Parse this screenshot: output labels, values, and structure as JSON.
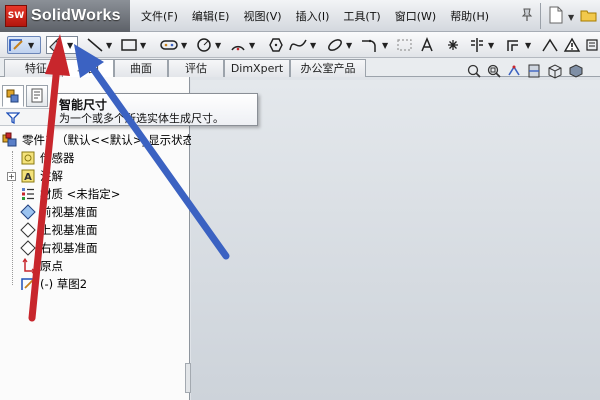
{
  "app": {
    "logo_mark": "SW",
    "logo_text": "SolidWorks"
  },
  "menu": [
    {
      "label": "文件(F)"
    },
    {
      "label": "编辑(E)"
    },
    {
      "label": "视图(V)"
    },
    {
      "label": "插入(I)"
    },
    {
      "label": "工具(T)"
    },
    {
      "label": "窗口(W)"
    },
    {
      "label": "帮助(H)"
    }
  ],
  "toolbar": {
    "icons": [
      "sketch-icon",
      "smart-dimension-icon",
      "line-icon",
      "rectangle-icon",
      "slot-icon",
      "circle-icon",
      "arc-icon",
      "polygon-icon",
      "spline-icon",
      "ellipse-icon",
      "fillet-icon",
      "construction-icon",
      "text-icon",
      "point-icon",
      "mirror-icon",
      "offset-icon",
      "relations-icon"
    ]
  },
  "tabs": [
    {
      "label": "特征"
    },
    {
      "label": "草图"
    },
    {
      "label": "曲面"
    },
    {
      "label": "评估"
    },
    {
      "label": "DimXpert"
    },
    {
      "label": "办公室产品"
    }
  ],
  "active_tab": "草图",
  "tooltip": {
    "title": "智能尺寸",
    "description": "为一个或多个所选实体生成尺寸。"
  },
  "tree": {
    "root": "零件1 （默认<<默认>_显示状态",
    "items": [
      {
        "label": "传感器"
      },
      {
        "label": "注解"
      },
      {
        "label": "材质 <未指定>"
      },
      {
        "label": "前视基准面"
      },
      {
        "label": "上视基准面"
      },
      {
        "label": "右视基准面"
      },
      {
        "label": "原点"
      },
      {
        "label": "(-) 草图2"
      }
    ]
  },
  "colors": {
    "red_arrow": "#c8262c",
    "blue_arrow": "#3b62c2",
    "accent": "#2f5aa8"
  }
}
